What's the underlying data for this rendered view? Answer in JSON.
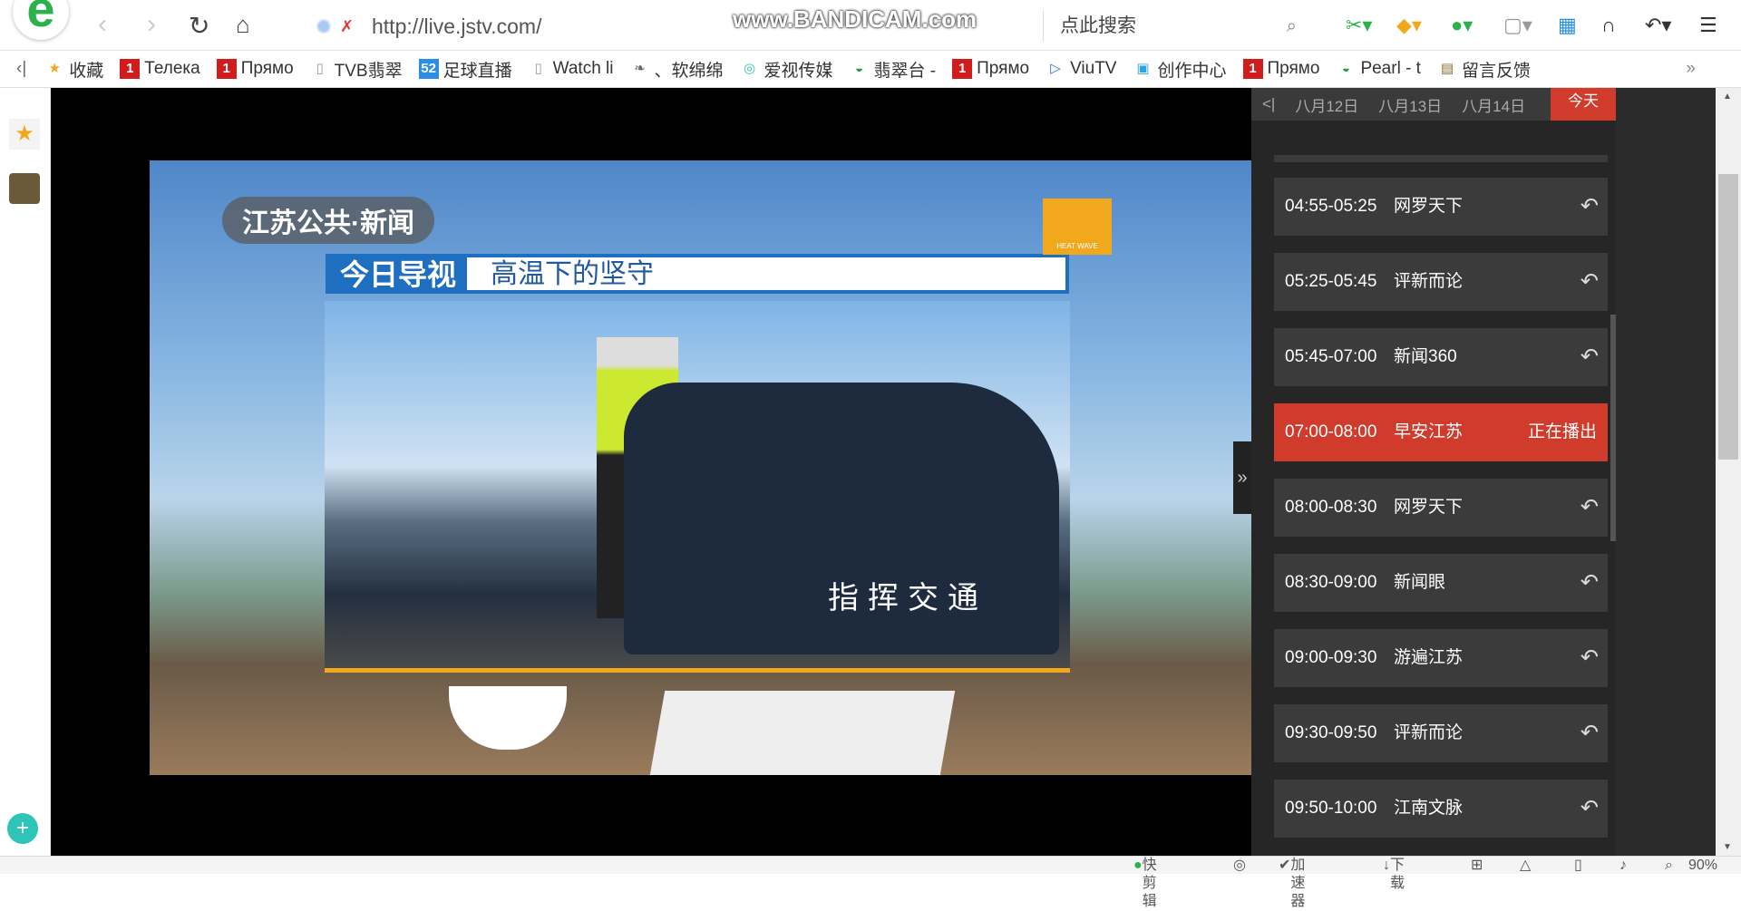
{
  "toolbar": {
    "url": "http://live.jstv.com/",
    "search_placeholder": "点此搜索",
    "watermark": "www.BANDICAM.com"
  },
  "bookmarks": [
    {
      "label": "收藏",
      "icon": "star-icon"
    },
    {
      "label": "Телека",
      "icon": "channel-one-icon"
    },
    {
      "label": "Прямо",
      "icon": "channel-one-icon"
    },
    {
      "label": "TVB翡翠",
      "icon": "page-icon"
    },
    {
      "label": "足球直播",
      "icon": "52-icon"
    },
    {
      "label": "Watch li",
      "icon": "page-icon"
    },
    {
      "label": "、软绵绵",
      "icon": "bird-icon"
    },
    {
      "label": "爱视传媒",
      "icon": "circle-icon"
    },
    {
      "label": "翡翠台 -",
      "icon": "tvb-icon"
    },
    {
      "label": "Прямо",
      "icon": "channel-one-icon"
    },
    {
      "label": "ViuTV",
      "icon": "viutv-icon"
    },
    {
      "label": "创作中心",
      "icon": "bilibili-icon"
    },
    {
      "label": "Прямо",
      "icon": "channel-one-icon"
    },
    {
      "label": "Pearl - t",
      "icon": "tvb-icon"
    },
    {
      "label": "留言反馈",
      "icon": "tv-icon"
    }
  ],
  "video": {
    "channel_logo": "江苏公共·新闻",
    "banner_left": "今日导视",
    "banner_right": "高温下的坚守",
    "caption": "指挥交通",
    "badge": "HEAT WAVE"
  },
  "schedule": {
    "dates": [
      "八月12日",
      "八月13日",
      "八月14日"
    ],
    "today": "今天",
    "items": [
      {
        "time": "04:55-05:25",
        "title": "网罗天下"
      },
      {
        "time": "05:25-05:45",
        "title": "评新而论"
      },
      {
        "time": "05:45-07:00",
        "title": "新闻360"
      },
      {
        "time": "07:00-08:00",
        "title": "早安江苏",
        "status": "正在播出"
      },
      {
        "time": "08:00-08:30",
        "title": "网罗天下"
      },
      {
        "time": "08:30-09:00",
        "title": "新闻眼"
      },
      {
        "time": "09:00-09:30",
        "title": "游遍江苏"
      },
      {
        "time": "09:30-09:50",
        "title": "评新而论"
      },
      {
        "time": "09:50-10:00",
        "title": "江南文脉"
      }
    ]
  },
  "statusbar": {
    "clip": "快剪辑",
    "accelerator": "加速器",
    "download": "下载",
    "zoom": "90%"
  },
  "colors": {
    "accent": "#d13b2c",
    "panel": "#262626",
    "item": "#3b3b3b"
  }
}
